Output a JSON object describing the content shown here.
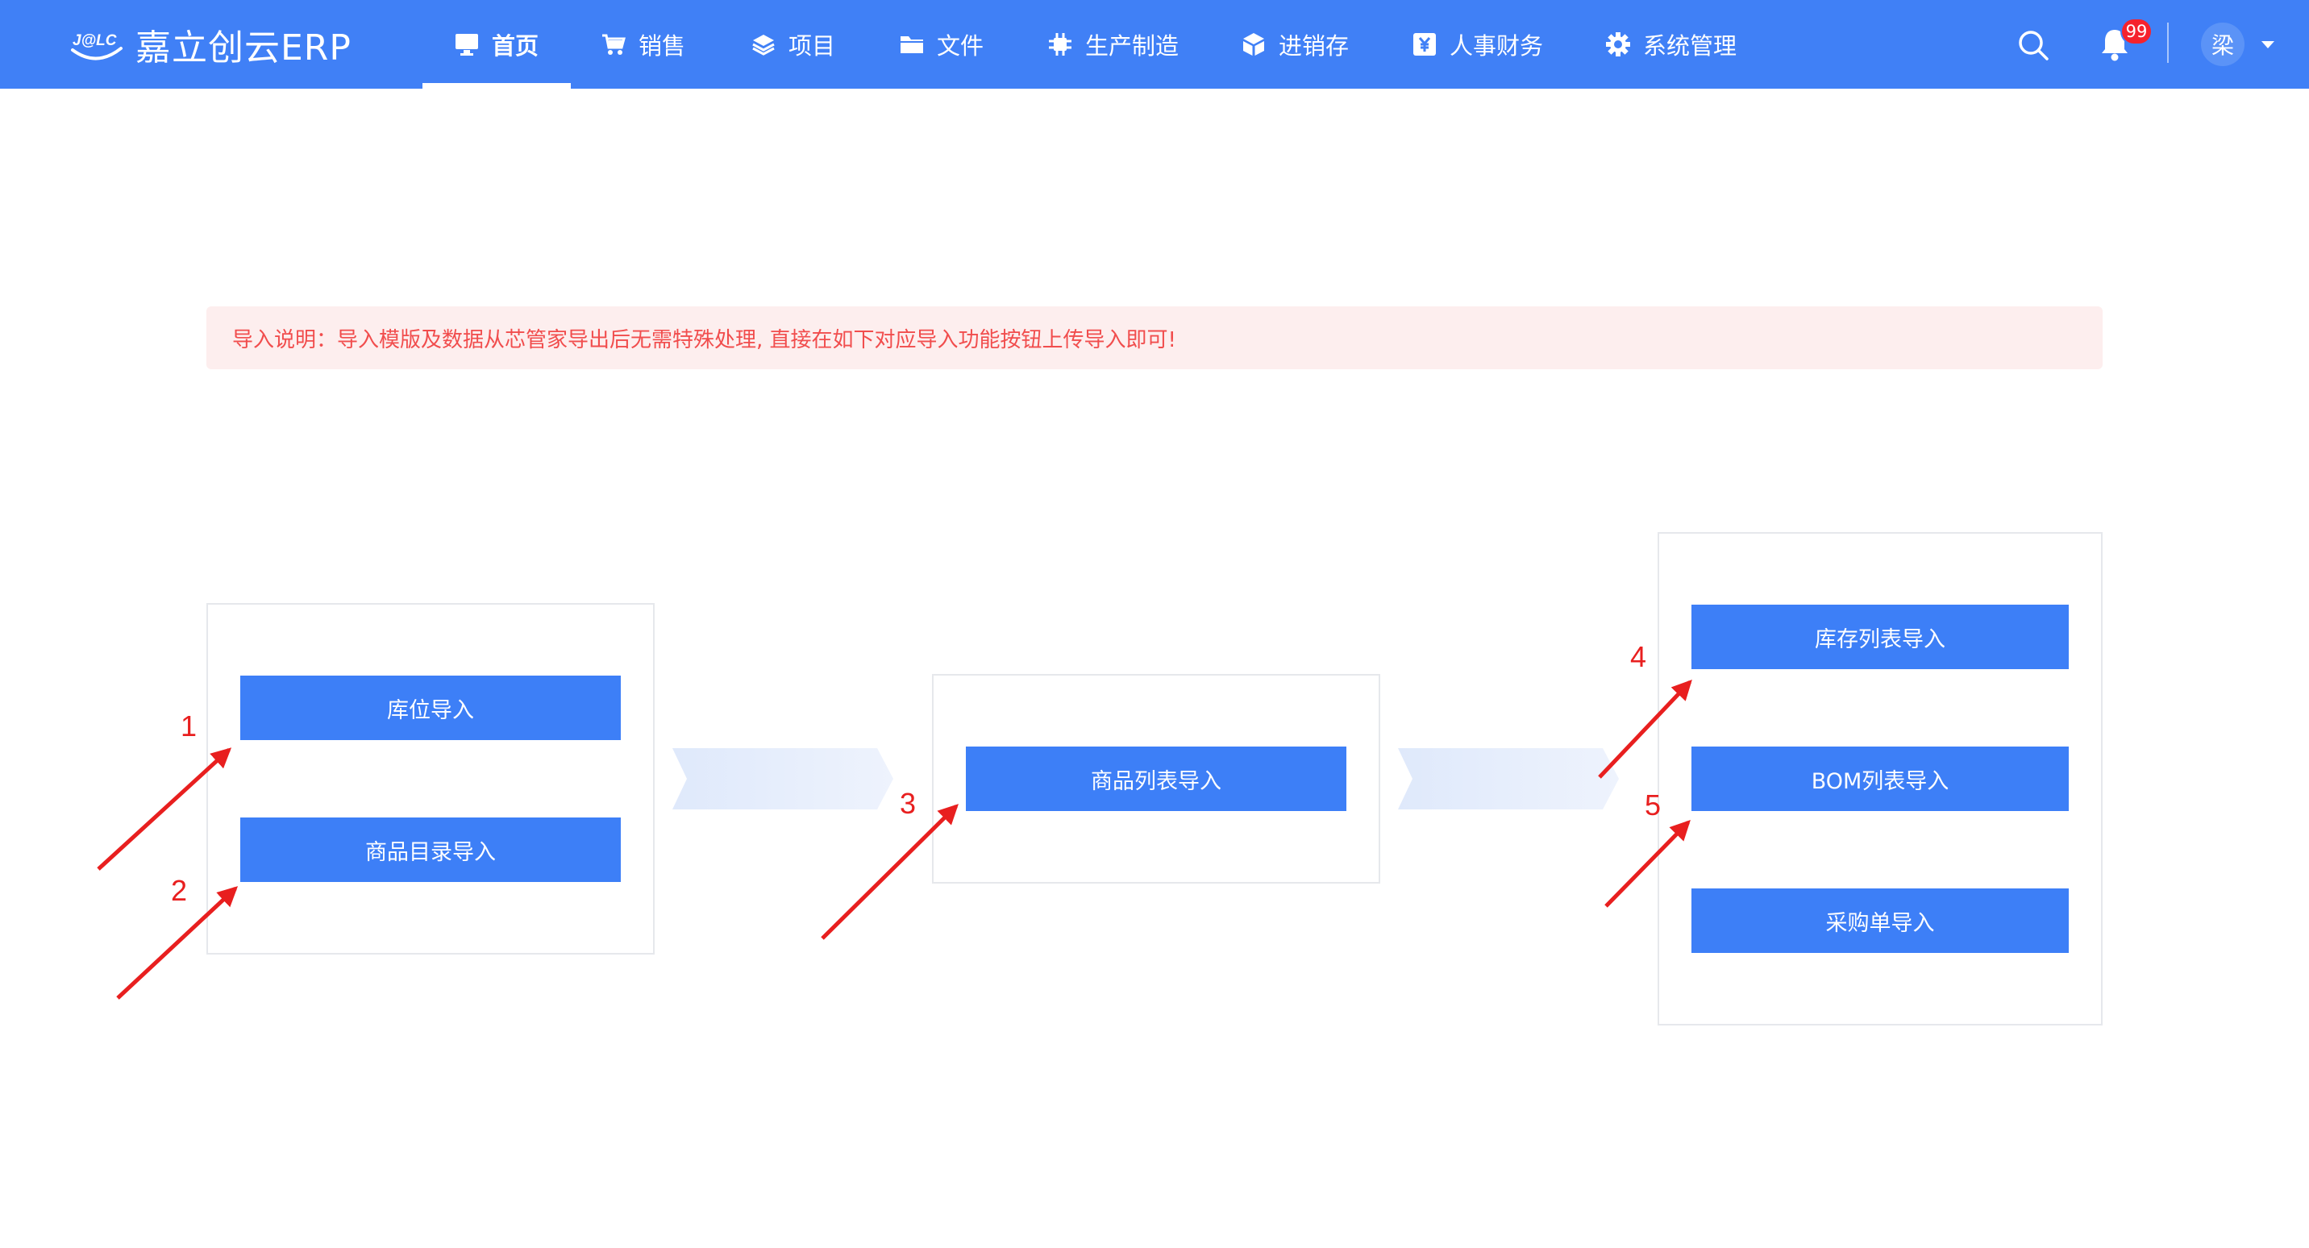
{
  "app": {
    "name": "嘉立创云ERP",
    "logo_mark": "J@LC"
  },
  "nav": {
    "items": [
      {
        "label": "首页",
        "icon": "monitor-icon",
        "active": true
      },
      {
        "label": "销售",
        "icon": "cart-icon"
      },
      {
        "label": "项目",
        "icon": "layers-icon"
      },
      {
        "label": "文件",
        "icon": "folder-icon"
      },
      {
        "label": "生产制造",
        "icon": "chip-icon"
      },
      {
        "label": "进销存",
        "icon": "cube-icon"
      },
      {
        "label": "人事财务",
        "icon": "yen-icon"
      },
      {
        "label": "系统管理",
        "icon": "gear-icon"
      }
    ]
  },
  "header": {
    "notification_count": "99",
    "user_avatar": "梁"
  },
  "notice": {
    "text": "导入说明：导入模版及数据从芯管家导出后无需特殊处理, 直接在如下对应导入功能按钮上传导入即可!"
  },
  "flow": {
    "group1": {
      "buttons": [
        "库位导入",
        "商品目录导入"
      ]
    },
    "group2": {
      "buttons": [
        "商品列表导入"
      ]
    },
    "group3": {
      "buttons": [
        "库存列表导入",
        "BOM列表导入",
        "采购单导入"
      ]
    }
  },
  "annotations": {
    "steps": [
      "1",
      "2",
      "3",
      "4",
      "5"
    ],
    "color": "#e81f1f"
  },
  "colors": {
    "header_bg": "#4080f6",
    "button_bg": "#3d7ff7",
    "notice_bg": "#fdeeee",
    "notice_text": "#f14d4d"
  }
}
